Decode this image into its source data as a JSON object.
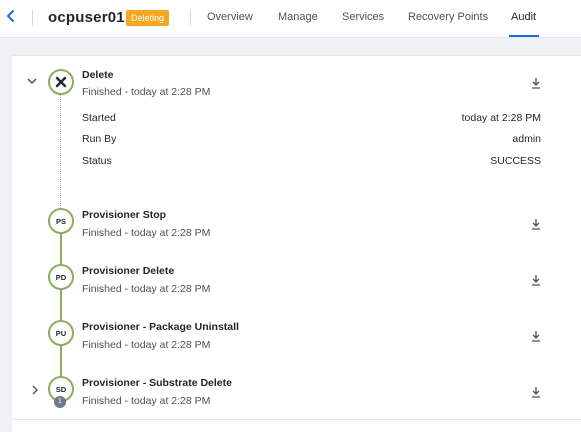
{
  "header": {
    "back_icon": "chevron-left-icon",
    "title": "ocpuser01",
    "status_badge": "Deleting",
    "tabs": [
      {
        "label": "Overview",
        "active": false
      },
      {
        "label": "Manage",
        "active": false
      },
      {
        "label": "Services",
        "active": false
      },
      {
        "label": "Recovery Points",
        "active": false
      },
      {
        "label": "Audit",
        "active": true
      }
    ],
    "accent_color": "#1b6cd8",
    "badge_color": "#f5a623"
  },
  "audit": {
    "expanded_step": {
      "title": "Delete",
      "subtitle": "Finished - today at 2:28 PM",
      "icon": "close-icon",
      "details": [
        {
          "label": "Started",
          "value": "today at 2:28 PM"
        },
        {
          "label": "Run By",
          "value": "admin"
        },
        {
          "label": "Status",
          "value": "SUCCESS"
        }
      ]
    },
    "steps": [
      {
        "initials": "PS",
        "title": "Provisioner Stop",
        "subtitle": "Finished - today at 2:28 PM"
      },
      {
        "initials": "PD",
        "title": "Provisioner Delete",
        "subtitle": "Finished - today at 2:28 PM"
      },
      {
        "initials": "PU",
        "title": "Provisioner - Package Uninstall",
        "subtitle": "Finished - today at 2:28 PM"
      },
      {
        "initials": "SD",
        "title": "Provisioner - Substrate Delete",
        "subtitle": "Finished - today at 2:28 PM",
        "count": "1"
      }
    ],
    "node_color": "#8bad5e"
  }
}
